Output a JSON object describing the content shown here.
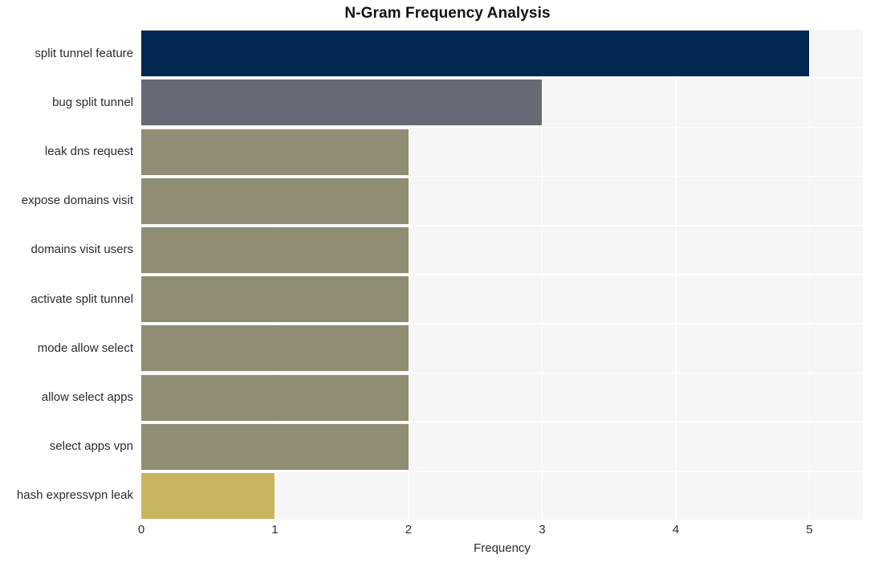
{
  "chart_data": {
    "type": "bar",
    "orientation": "horizontal",
    "title": "N-Gram Frequency Analysis",
    "xlabel": "Frequency",
    "ylabel": "",
    "categories": [
      "split tunnel feature",
      "bug split tunnel",
      "leak dns request",
      "expose domains visit",
      "domains visit users",
      "activate split tunnel",
      "mode allow select",
      "allow select apps",
      "select apps vpn",
      "hash expressvpn leak"
    ],
    "values": [
      5,
      3,
      2,
      2,
      2,
      2,
      2,
      2,
      2,
      1
    ],
    "bar_colors": [
      "#022750",
      "#666a75",
      "#918d74",
      "#918d74",
      "#918d74",
      "#918d74",
      "#918d74",
      "#918d74",
      "#918d74",
      "#c9b560"
    ],
    "xlim": [
      0,
      5.4
    ],
    "xticks": [
      0,
      1,
      2,
      3,
      4,
      5
    ],
    "xtick_labels": [
      "0",
      "1",
      "2",
      "3",
      "4",
      "5"
    ],
    "grid": true,
    "grid_color": "#ffffff",
    "plot_background": "#f6f6f6",
    "figure_background": "#ffffff",
    "legend": null
  }
}
